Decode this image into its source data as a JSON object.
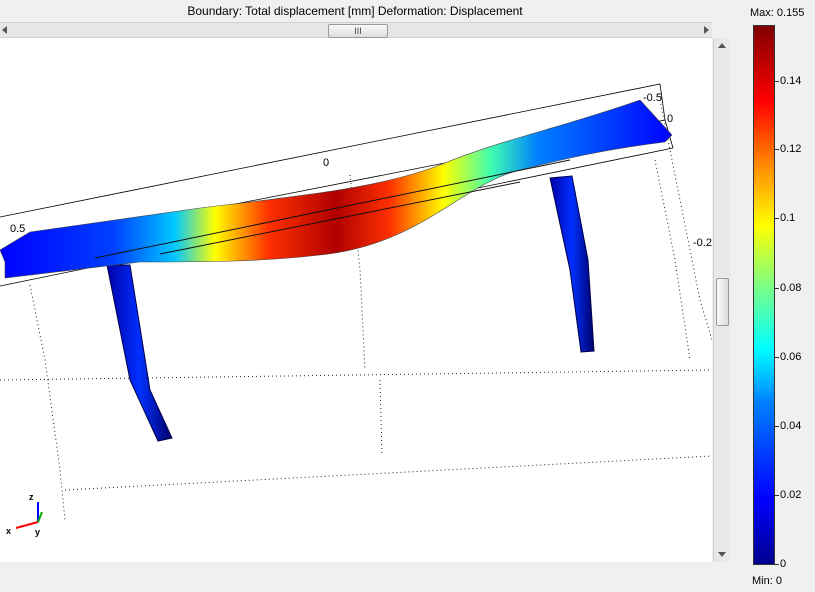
{
  "header": {
    "title": "Boundary: Total displacement [mm]   Deformation: Displacement"
  },
  "scrollbar": {
    "thumb_grip": "III"
  },
  "plot": {
    "axis_labels": [
      "-0.5",
      "0",
      "0",
      "0.5",
      "-0.2"
    ],
    "triad": {
      "z": "z",
      "x": "x",
      "y": "y"
    }
  },
  "legend": {
    "max_label": "Max: 0.155",
    "min_label": "Min: 0",
    "ticks": [
      "0.14",
      "0.12",
      "0.1",
      "0.08",
      "0.06",
      "0.04",
      "0.02",
      "0"
    ],
    "colors": {
      "min": "#00008f",
      "low": "#0000ff",
      "mid": "#00ffff",
      "high": "#ffff00",
      "max": "#800000"
    }
  }
}
